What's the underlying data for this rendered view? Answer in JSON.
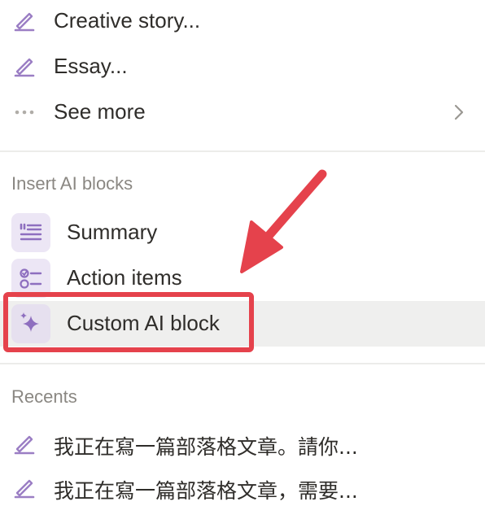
{
  "ai_actions": [
    {
      "label": "Creative story...",
      "icon": "pencil-icon"
    },
    {
      "label": "Essay...",
      "icon": "pencil-icon"
    },
    {
      "label": "See more",
      "icon": "more-dots-icon"
    }
  ],
  "insert_blocks": {
    "title": "Insert AI blocks",
    "items": [
      {
        "label": "Summary",
        "icon": "summary-icon"
      },
      {
        "label": "Action items",
        "icon": "checklist-icon"
      },
      {
        "label": "Custom AI block",
        "icon": "sparkle-icon"
      }
    ]
  },
  "recents": {
    "title": "Recents",
    "items": [
      {
        "label": "我正在寫一篇部落格文章。請你...",
        "icon": "pencil-icon"
      },
      {
        "label": "我正在寫一篇部落格文章，需要...",
        "icon": "pencil-icon"
      }
    ]
  },
  "colors": {
    "accent_purple": "#9b7ec4",
    "highlight_red": "#e5424c",
    "hover_bg": "#efefee"
  }
}
